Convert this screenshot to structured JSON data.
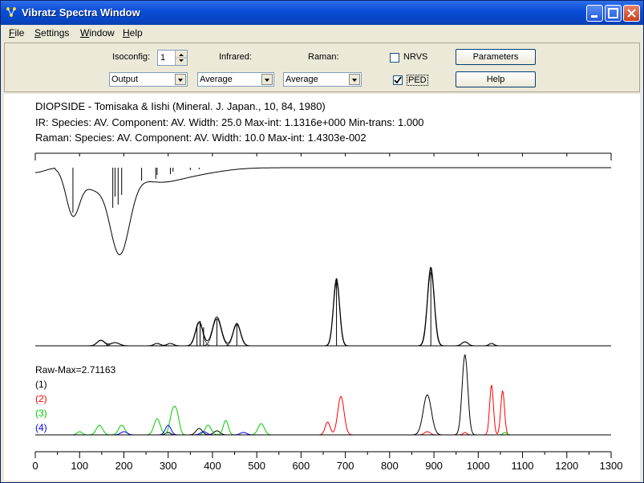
{
  "window": {
    "title": "Vibratz Spectra Window"
  },
  "menu": [
    {
      "key": "F",
      "rest": "ile"
    },
    {
      "key": "S",
      "rest": "ettings"
    },
    {
      "key": "W",
      "rest": "indow"
    },
    {
      "key": "H",
      "rest": "elp"
    }
  ],
  "toolbar": {
    "isoconfig_label": "Isoconfig:",
    "isoconfig_value": "1",
    "infrared_label": "Infrared:",
    "raman_label": "Raman:",
    "nrvs_label": "NRVS",
    "ped_label": "PED",
    "nrvs_checked": false,
    "ped_checked": true,
    "output_select": "Output",
    "infrared_select": "Average",
    "raman_select": "Average",
    "parameters_button": "Parameters",
    "help_button": "Help"
  },
  "plot": {
    "header_line1": "DIOPSIDE - Tomisaka & Iishi (Mineral. J. Japan., 10, 84, 1980)",
    "header_line2": "IR: Species: AV.  Component: AV.  Width:  25.0 Max-int: 1.1316e+000 Min-trans:  1.000",
    "header_line3": "Raman: Species: AV.  Component: AV. Width:  10.0 Max-int: 1.4303e-002",
    "raw_max": "Raw-Max=2.71163",
    "ped_labels": [
      {
        "text": "(1)",
        "color": "#000000"
      },
      {
        "text": "(2)",
        "color": "#ff0000"
      },
      {
        "text": "(3)",
        "color": "#00cc00"
      },
      {
        "text": "(4)",
        "color": "#0000ff"
      }
    ],
    "axis_ticks": [
      "0",
      "100",
      "200",
      "300",
      "400",
      "500",
      "600",
      "700",
      "800",
      "900",
      "1000",
      "1100",
      "1200",
      "1300"
    ]
  }
}
